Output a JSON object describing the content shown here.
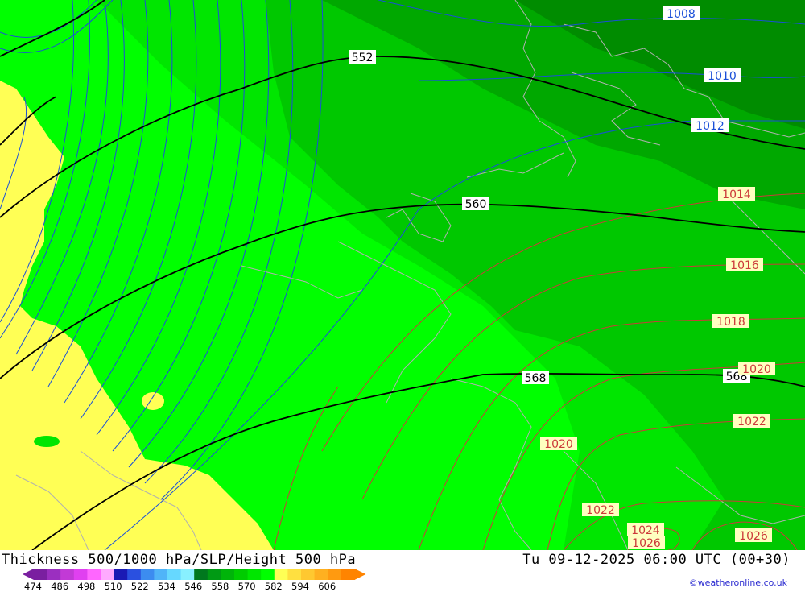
{
  "map": {
    "thickness_levels": [
      "552",
      "560",
      "568"
    ],
    "isobars_blue": [
      "1008",
      "1010",
      "1012"
    ],
    "isobars_red": [
      "1014",
      "1016",
      "1018",
      "1020",
      "1020",
      "1022",
      "1022",
      "1024",
      "1026",
      "1026"
    ],
    "colors": {
      "yellow": "#ffff55",
      "green_light": "#00ff00",
      "green_mid": "#00e600",
      "green_dark": "#00c800",
      "green_darker": "#00a800",
      "green_darkest": "#008c00",
      "isobar_blue": "#1a4fd8",
      "isobar_red": "#cc3a3a",
      "thickness_line": "#000000",
      "coast": "#b0b0b0"
    }
  },
  "footer": {
    "title_left": "Thickness 500/1000 hPa/SLP/Height 500 hPa",
    "title_right": "Tu 09-12-2025 06:00 UTC (00+30)",
    "credit": "©weatheronline.co.uk",
    "legend_ticks": [
      "474",
      "486",
      "498",
      "510",
      "522",
      "534",
      "546",
      "558",
      "570",
      "582",
      "594",
      "606"
    ],
    "legend_colors": [
      "#7a1fa0",
      "#9b2fc0",
      "#c23ad6",
      "#e040f0",
      "#ff66ff",
      "#ffaaff",
      "#1a1ab4",
      "#2a50e0",
      "#3c8cf0",
      "#50b4f8",
      "#66d8ff",
      "#88f0ff",
      "#00781e",
      "#009a14",
      "#00b40a",
      "#00cc00",
      "#00e600",
      "#00ff00",
      "#ffff55",
      "#ffe040",
      "#ffc830",
      "#ffb020",
      "#ff9a10",
      "#ff8400"
    ]
  }
}
